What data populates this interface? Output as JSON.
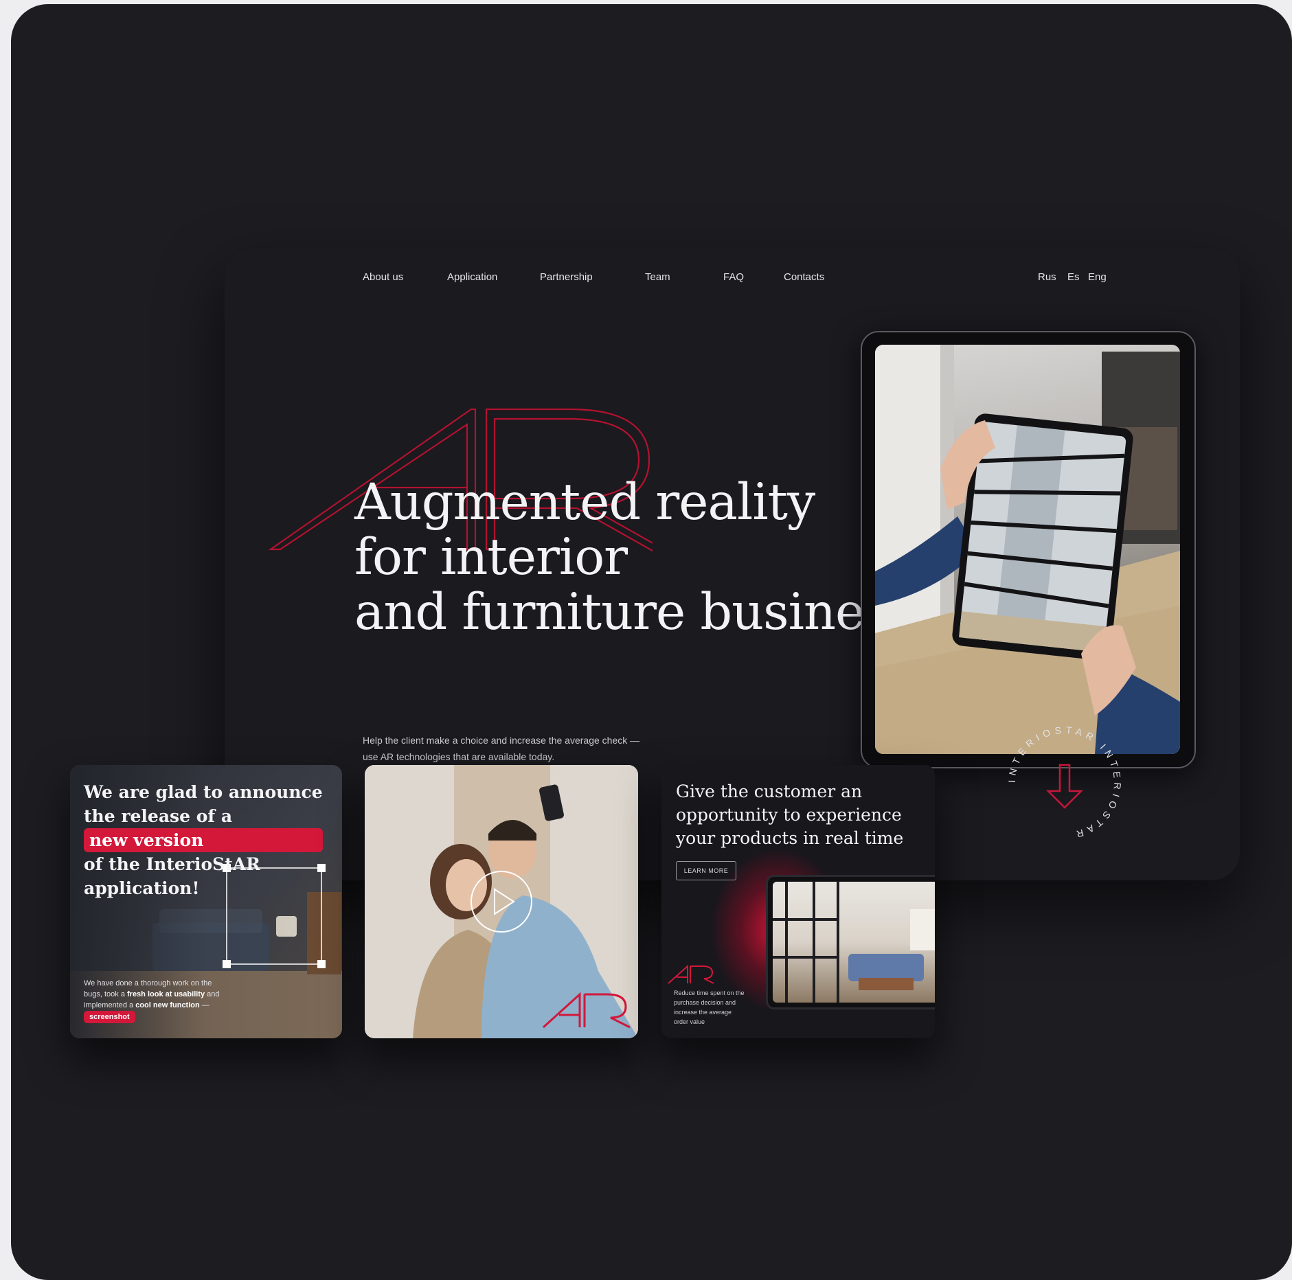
{
  "nav": {
    "items": [
      "About us",
      "Application",
      "Partnership",
      "Team",
      "FAQ",
      "Contacts"
    ],
    "languages": [
      "Rus",
      "Es",
      "Eng"
    ]
  },
  "hero": {
    "decor_letters": "AR",
    "headline": [
      "Augmented reality",
      "for interior",
      "and furniture business"
    ],
    "subtext": [
      "Help the client make a choice and increase the average check —",
      "use AR technologies that are available today."
    ]
  },
  "badge": {
    "ring_text": "INTERIOSTAR INTERIOSTAR",
    "icon": "arrow-down-icon"
  },
  "cards": {
    "announce": {
      "title_lines": [
        "We are glad to announce",
        "the release of a",
        "of the InterioStAR",
        "application!"
      ],
      "highlight": "new version",
      "body_lines": [
        [
          "We have done a thorough work on the",
          ""
        ],
        [
          "bugs, took a ",
          "fresh look at usability",
          " and"
        ],
        [
          "implemented a ",
          "cool new function",
          " —"
        ]
      ],
      "tag": "screenshot"
    },
    "video": {
      "icon": "play-icon",
      "logo": "AR"
    },
    "experience": {
      "title_lines": [
        "Give the customer an",
        "opportunity to experience",
        "your products in real time"
      ],
      "button": "LEARN MORE",
      "logo": "AR",
      "note_lines": [
        "Reduce time spent on the",
        "purchase decision and",
        "increase the average",
        "order value"
      ]
    }
  },
  "colors": {
    "background": "#1c1c21",
    "accent": "#d3183a",
    "text": "#f3f3f5"
  }
}
